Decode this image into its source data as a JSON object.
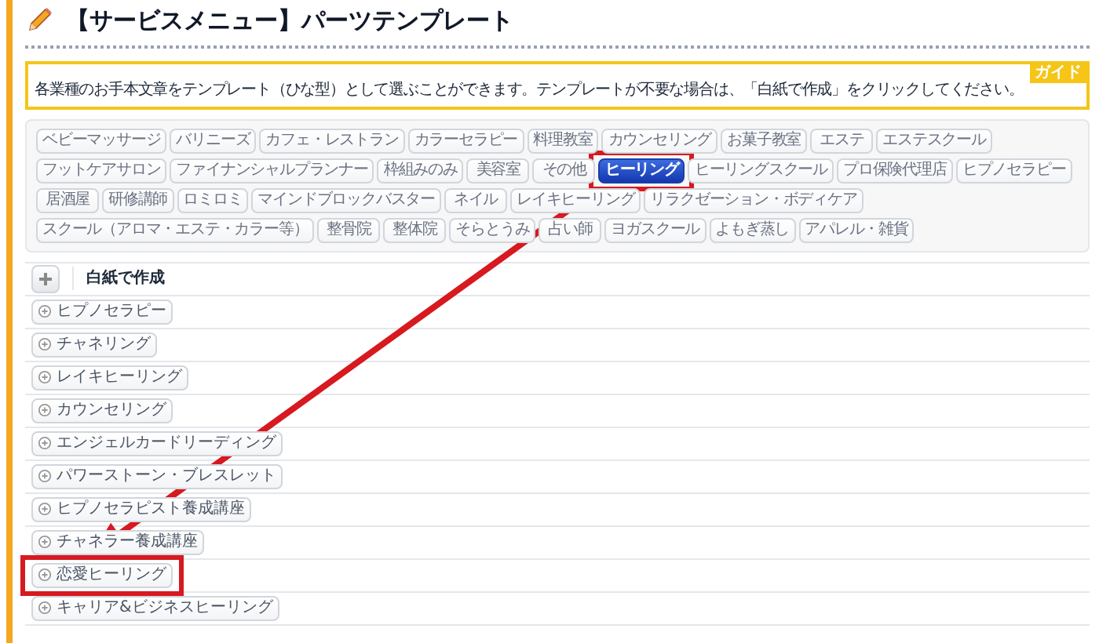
{
  "title": "【サービスメニュー】パーツテンプレート",
  "guide": {
    "badge": "ガイド",
    "text": "各業種のお手本文章をテンプレート（ひな型）として選ぶことができます。テンプレートが不要な場合は、「白紙で作成」をクリックしてください。"
  },
  "categories": [
    {
      "label": "ベビーマッサージ",
      "selected": false,
      "highlighted": false
    },
    {
      "label": "バリニーズ",
      "selected": false,
      "highlighted": false
    },
    {
      "label": "カフェ・レストラン",
      "selected": false,
      "highlighted": false
    },
    {
      "label": "カラーセラピー",
      "selected": false,
      "highlighted": false
    },
    {
      "label": "料理教室",
      "selected": false,
      "highlighted": false
    },
    {
      "label": "カウンセリング",
      "selected": false,
      "highlighted": false
    },
    {
      "label": "お菓子教室",
      "selected": false,
      "highlighted": false
    },
    {
      "label": "エステ",
      "selected": false,
      "highlighted": false
    },
    {
      "label": "エステスクール",
      "selected": false,
      "highlighted": false
    },
    {
      "label": "フットケアサロン",
      "selected": false,
      "highlighted": false
    },
    {
      "label": "ファイナンシャルプランナー",
      "selected": false,
      "highlighted": false
    },
    {
      "label": "枠組みのみ",
      "selected": false,
      "highlighted": false
    },
    {
      "label": "美容室",
      "selected": false,
      "highlighted": false
    },
    {
      "label": "その他",
      "selected": false,
      "highlighted": false
    },
    {
      "label": "ヒーリング",
      "selected": true,
      "highlighted": true
    },
    {
      "label": "ヒーリングスクール",
      "selected": false,
      "highlighted": false
    },
    {
      "label": "プロ保険代理店",
      "selected": false,
      "highlighted": false
    },
    {
      "label": "ヒプノセラピー",
      "selected": false,
      "highlighted": false
    },
    {
      "label": "居酒屋",
      "selected": false,
      "highlighted": false
    },
    {
      "label": "研修講師",
      "selected": false,
      "highlighted": false
    },
    {
      "label": "ロミロミ",
      "selected": false,
      "highlighted": false
    },
    {
      "label": "マインドブロックバスター",
      "selected": false,
      "highlighted": false
    },
    {
      "label": "ネイル",
      "selected": false,
      "highlighted": false
    },
    {
      "label": "レイキヒーリング",
      "selected": false,
      "highlighted": false
    },
    {
      "label": "リラクゼーション・ボディケア",
      "selected": false,
      "highlighted": false
    },
    {
      "label": "スクール（アロマ・エステ・カラー等）",
      "selected": false,
      "highlighted": false
    },
    {
      "label": "整骨院",
      "selected": false,
      "highlighted": false
    },
    {
      "label": "整体院",
      "selected": false,
      "highlighted": false
    },
    {
      "label": "そらとうみ",
      "selected": false,
      "highlighted": false
    },
    {
      "label": "占い師",
      "selected": false,
      "highlighted": false
    },
    {
      "label": "ヨガスクール",
      "selected": false,
      "highlighted": false
    },
    {
      "label": "よもぎ蒸し",
      "selected": false,
      "highlighted": false
    },
    {
      "label": "アパレル・雑貨",
      "selected": false,
      "highlighted": false
    }
  ],
  "blank": {
    "label": "白紙で作成"
  },
  "templates": [
    {
      "label": "ヒプノセラピー",
      "highlighted": false
    },
    {
      "label": "チャネリング",
      "highlighted": false
    },
    {
      "label": "レイキヒーリング",
      "highlighted": false
    },
    {
      "label": "カウンセリング",
      "highlighted": false
    },
    {
      "label": "エンジェルカードリーディング",
      "highlighted": false
    },
    {
      "label": "パワーストーン・ブレスレット",
      "highlighted": false
    },
    {
      "label": "ヒプノセラピスト養成講座",
      "highlighted": false
    },
    {
      "label": "チャネラー養成講座",
      "highlighted": false
    },
    {
      "label": "恋愛ヒーリング",
      "highlighted": true
    },
    {
      "label": "キャリア&ビジネスヒーリング",
      "highlighted": false
    }
  ]
}
